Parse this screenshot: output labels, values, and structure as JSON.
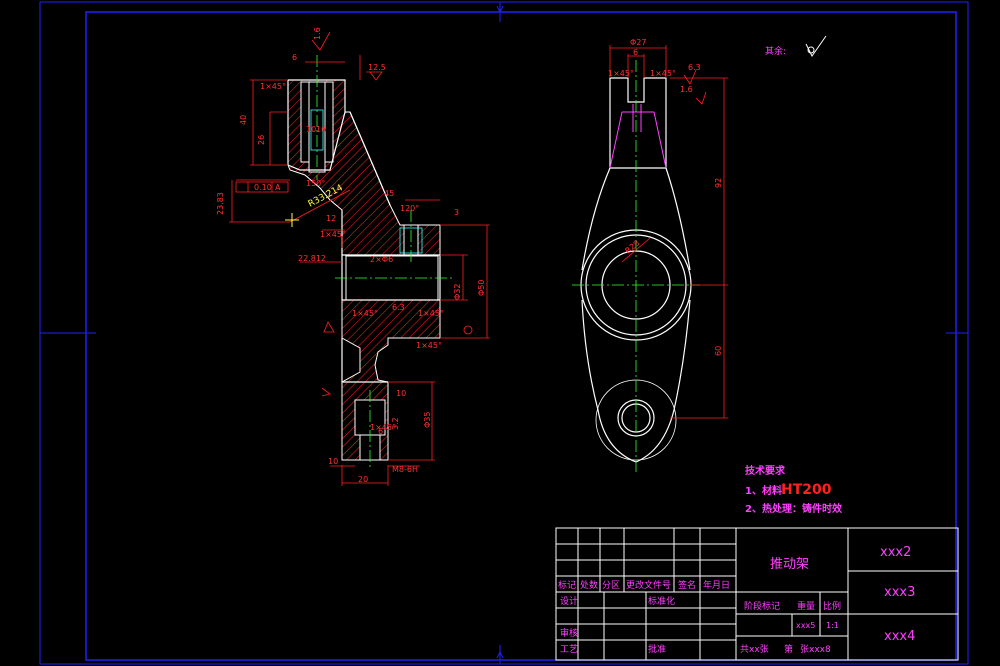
{
  "colors": {
    "background": "#000000",
    "frame": "#2020ff",
    "outline": "#ffffff",
    "dimension": "#ff2020",
    "centerline": "#30ff30",
    "title_block_text": "#ff40ff",
    "hatch": "#ff2020",
    "cyan": "#40ffff",
    "yellow": "#ffff40"
  },
  "roughness_note": "其余:",
  "tech_requirements": {
    "heading": "技术要求",
    "line1_prefix": "1、材料:",
    "line1_material": "HT200",
    "line2": "2、热处理：铸件时效"
  },
  "section_view_dims": {
    "top_roughness": "12.5",
    "roughness_16": "1.6",
    "width_6": "6",
    "chamfer_top": "1×45°",
    "dim_40": "40",
    "dim_26": "26",
    "dim_10": "10",
    "dim_16": "16",
    "tolerance_value": "0.10",
    "tolerance_datum": "A",
    "dim_23": "23.83",
    "dim_150": "150°",
    "radius": "R33.214",
    "dim_45": "45",
    "angle_120": "120°",
    "dim_12": "12",
    "chamfer_mid": "1×45°",
    "dim_22": "22.812",
    "dim_phi6": "2×Φ6",
    "dim_32": "Φ32",
    "dim_50": "Φ50",
    "chamfer_a": "1×45°",
    "chamfer_b": "1×45°",
    "roughness_63": "6.3",
    "chamfer_c": "1×45°",
    "dim_10b": "10",
    "dim_phi35": "Φ35",
    "roughness_32": "3.2",
    "chamfer_d": "1×45°",
    "dim_10c": "10",
    "thread": "M8-6H",
    "dim_20": "20",
    "dim_6b": "6",
    "label_3": "3"
  },
  "front_view_dims": {
    "dia_27": "Φ27",
    "width_6": "6",
    "chamfer_l": "1×45°",
    "chamfer_r": "1×45°",
    "roughness_63": "6.3",
    "roughness_16": "1.6",
    "dim_92": "92",
    "dim_60": "60",
    "radius": "R28"
  },
  "title_block": {
    "part_name": "推动架",
    "code_1": "xxx2",
    "code_2": "xxx3",
    "code_3": "xxx4",
    "col_mark": "标记",
    "col_count": "处数",
    "col_zone": "分区",
    "col_doc": "更改文件号",
    "col_sign": "签名",
    "col_date": "年月日",
    "row_design": "设计",
    "row_standard": "标准化",
    "row_review": "审核",
    "row_process": "工艺",
    "row_approve": "批准",
    "stage_mark": "阶段标记",
    "weight": "重量",
    "scale": "比例",
    "stage_value": "xxx5",
    "scale_value": "1:1",
    "sheets": "共xx张",
    "sheet_prefix": "第",
    "sheet_value": "张xxx8"
  }
}
